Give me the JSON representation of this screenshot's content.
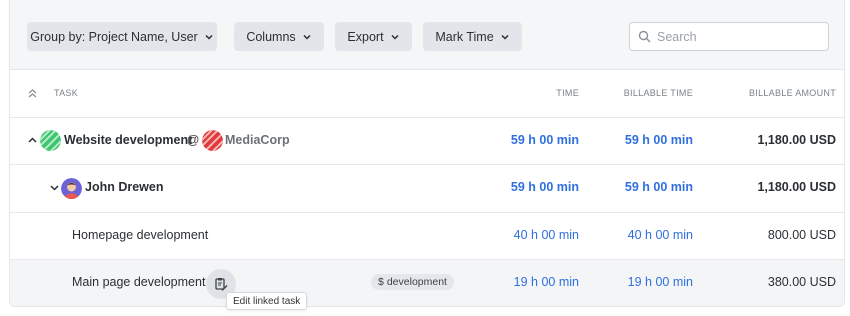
{
  "toolbar": {
    "group_by_label": "Group by: Project Name, User",
    "columns_label": "Columns",
    "export_label": "Export",
    "mark_time_label": "Mark Time",
    "search_placeholder": "Search"
  },
  "table": {
    "headers": {
      "task": "TASK",
      "time": "TIME",
      "billable_time": "BILLABLE TIME",
      "billable_amount": "BILLABLE AMOUNT"
    },
    "project_row": {
      "project": "Website development",
      "at": "@",
      "client": "MediaCorp",
      "time": "59 h 00 min",
      "billable_time": "59 h 00 min",
      "billable_amount": "1,180.00 USD",
      "project_color": "#3fc46f",
      "client_color": "#e23a3a"
    },
    "user_row": {
      "name": "John Drewen",
      "time": "59 h 00 min",
      "billable_time": "59 h 00 min",
      "billable_amount": "1,180.00 USD"
    },
    "task_rows": [
      {
        "name": "Homepage development",
        "time": "40 h 00 min",
        "billable_time": "40 h 00 min",
        "billable_amount": "800.00 USD"
      },
      {
        "name": "Main page development",
        "tag": "development",
        "tag_symbol": "$",
        "time": "19 h 00 min",
        "billable_time": "19 h 00 min",
        "billable_amount": "380.00 USD"
      }
    ]
  },
  "tooltip": "Edit linked task",
  "colors": {
    "accent_blue": "#2f6fdf",
    "toolbar_bg": "#f5f6f8",
    "button_bg": "#e2e6ea"
  }
}
